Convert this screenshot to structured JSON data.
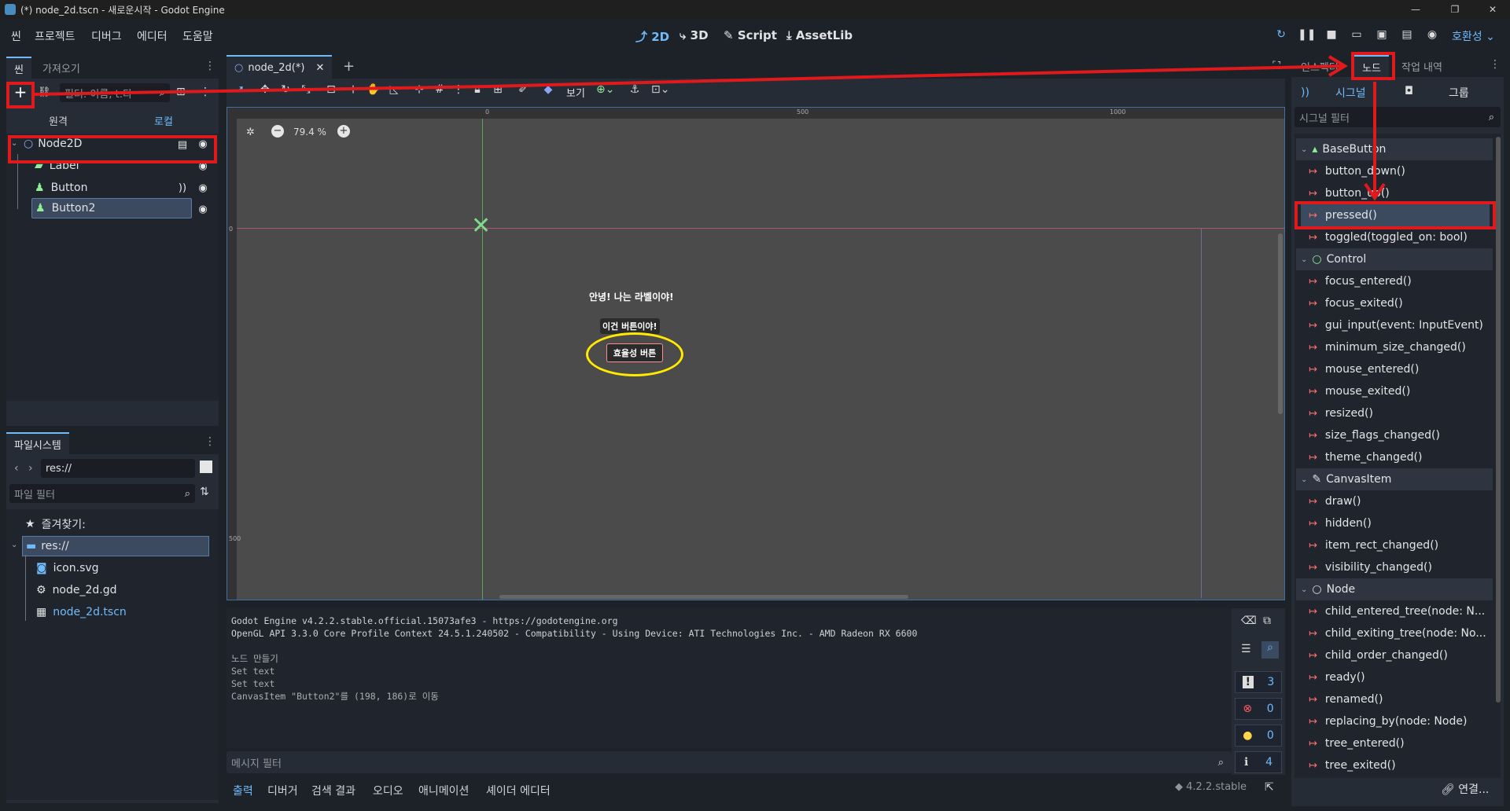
{
  "window": {
    "title": "(*) node_2d.tscn - 새로운시작 - Godot Engine",
    "min": "—",
    "max": "❐",
    "close": "✕"
  },
  "menu": [
    "씬",
    "프로젝트",
    "디버그",
    "에디터",
    "도움말"
  ],
  "workspaces": [
    "2D",
    "3D",
    "Script",
    "AssetLib"
  ],
  "renderer": "호환성",
  "left_dock": {
    "tabs": [
      "씬",
      "가져오기"
    ],
    "filter_placeholder": "필터: 이름, t:타",
    "mode_tabs": [
      "원격",
      "로컬"
    ],
    "tree": [
      {
        "label": "Node2D"
      },
      {
        "label": "Label"
      },
      {
        "label": "Button"
      },
      {
        "label": "Button2"
      }
    ]
  },
  "filesystem": {
    "tab": "파일시스템",
    "path": "res://",
    "filter_placeholder": "파일 필터",
    "items": [
      {
        "label": "즐겨찾기:"
      },
      {
        "label": "res://"
      },
      {
        "label": "icon.svg"
      },
      {
        "label": "node_2d.gd"
      },
      {
        "label": "node_2d.tscn"
      }
    ]
  },
  "editor": {
    "scene_tab": "node_2d(*)",
    "view_menu": "보기",
    "zoom": "79.4 %",
    "ruler": [
      "0",
      "500",
      "1000"
    ],
    "ruler_v": [
      "0",
      "500"
    ],
    "label_text": "안녕! 나는 라벨이야!",
    "button_text": "이건 버튼이야!",
    "button2_text": "효율성 버튼"
  },
  "output": {
    "lines": [
      "Godot Engine v4.2.2.stable.official.15073afe3 - https://godotengine.org",
      "OpenGL API 3.3.0 Core Profile Context 24.5.1.240502 - Compatibility - Using Device: ATI Technologies Inc. - AMD Radeon RX 6600",
      "",
      "노드 만들기",
      "Set text",
      "Set text",
      "CanvasItem \"Button2\"를 (198, 186)로 이동"
    ],
    "filter_placeholder": "메시지 필터",
    "counts": [
      "3",
      "0",
      "0",
      "4"
    ],
    "bottom_tabs": [
      "출력",
      "디버거",
      "검색 결과",
      "오디오",
      "애니메이션",
      "셰이더 에디터"
    ],
    "version": "4.2.2.stable"
  },
  "right_dock": {
    "tabs": [
      "인스펙터",
      "노드",
      "작업 내역"
    ],
    "sub_tabs": [
      "시그널",
      "그룹"
    ],
    "filter_placeholder": "시그널 필터",
    "categories": [
      {
        "name": "BaseButton",
        "signals": [
          "button_down()",
          "button_up()",
          "pressed()",
          "toggled(toggled_on: bool)"
        ]
      },
      {
        "name": "Control",
        "signals": [
          "focus_entered()",
          "focus_exited()",
          "gui_input(event: InputEvent)",
          "minimum_size_changed()",
          "mouse_entered()",
          "mouse_exited()",
          "resized()",
          "size_flags_changed()",
          "theme_changed()"
        ]
      },
      {
        "name": "CanvasItem",
        "signals": [
          "draw()",
          "hidden()",
          "item_rect_changed()",
          "visibility_changed()"
        ]
      },
      {
        "name": "Node",
        "signals": [
          "child_entered_tree(node: N...",
          "child_exiting_tree(node: No...",
          "child_order_changed()",
          "ready()",
          "renamed()",
          "replacing_by(node: Node)",
          "tree_entered()",
          "tree_exited()"
        ]
      }
    ],
    "connect_button": "연결..."
  }
}
